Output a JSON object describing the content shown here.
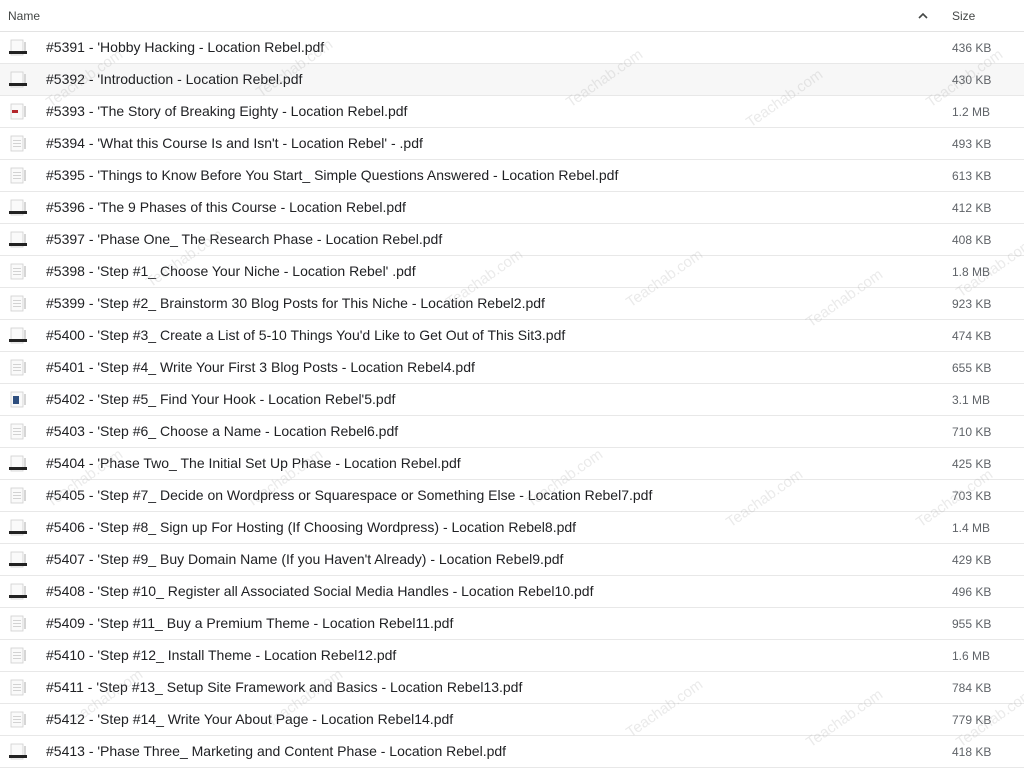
{
  "header": {
    "name_label": "Name",
    "size_label": "Size",
    "sort_icon": "chevron-up-icon"
  },
  "files": [
    {
      "name": "#5391 - 'Hobby Hacking - Location Rebel.pdf",
      "size": "436 KB",
      "thumb": "dark"
    },
    {
      "name": "#5392 - 'Introduction - Location Rebel.pdf",
      "size": "430 KB",
      "thumb": "dark"
    },
    {
      "name": "#5393 - 'The Story of Breaking Eighty - Location Rebel.pdf",
      "size": "1.2 MB",
      "thumb": "red"
    },
    {
      "name": "#5394 - 'What this Course Is and Isn't - Location Rebel' - .pdf",
      "size": "493 KB",
      "thumb": "light"
    },
    {
      "name": "#5395 - 'Things to Know Before You Start_ Simple Questions Answered - Location Rebel.pdf",
      "size": "613 KB",
      "thumb": "light"
    },
    {
      "name": "#5396 - 'The 9 Phases of this Course - Location Rebel.pdf",
      "size": "412 KB",
      "thumb": "dark"
    },
    {
      "name": "#5397 - 'Phase One_ The Research Phase - Location Rebel.pdf",
      "size": "408 KB",
      "thumb": "dark"
    },
    {
      "name": "#5398 - 'Step #1_ Choose Your Niche - Location Rebel' .pdf",
      "size": "1.8 MB",
      "thumb": "light"
    },
    {
      "name": "#5399 - 'Step #2_ Brainstorm 30 Blog Posts for This Niche - Location Rebel2.pdf",
      "size": "923 KB",
      "thumb": "light"
    },
    {
      "name": "#5400 - 'Step #3_ Create a List of 5-10 Things You'd Like to Get Out of This Sit3.pdf",
      "size": "474 KB",
      "thumb": "dark"
    },
    {
      "name": "#5401 - 'Step #4_ Write Your First 3 Blog Posts - Location Rebel4.pdf",
      "size": "655 KB",
      "thumb": "light"
    },
    {
      "name": "#5402 - 'Step #5_ Find Your Hook - Location Rebel'5.pdf",
      "size": "3.1 MB",
      "thumb": "blue"
    },
    {
      "name": "#5403 - 'Step #6_ Choose a Name - Location Rebel6.pdf",
      "size": "710 KB",
      "thumb": "light"
    },
    {
      "name": "#5404 - 'Phase Two_ The Initial Set Up Phase - Location Rebel.pdf",
      "size": "425 KB",
      "thumb": "dark"
    },
    {
      "name": "#5405 - 'Step #7_ Decide on Wordpress or Squarespace or Something Else - Location Rebel7.pdf",
      "size": "703 KB",
      "thumb": "light"
    },
    {
      "name": "#5406 - 'Step #8_ Sign up For Hosting (If Choosing Wordpress) - Location Rebel8.pdf",
      "size": "1.4 MB",
      "thumb": "dark"
    },
    {
      "name": "#5407 - 'Step #9_ Buy Domain Name (If you Haven't Already) - Location Rebel9.pdf",
      "size": "429 KB",
      "thumb": "dark"
    },
    {
      "name": "#5408 - 'Step #10_ Register all Associated Social Media Handles - Location Rebel10.pdf",
      "size": "496 KB",
      "thumb": "dark"
    },
    {
      "name": "#5409 - 'Step #11_ Buy a Premium Theme - Location Rebel11.pdf",
      "size": "955 KB",
      "thumb": "light"
    },
    {
      "name": "#5410 - 'Step #12_ Install Theme - Location Rebel12.pdf",
      "size": "1.6 MB",
      "thumb": "light"
    },
    {
      "name": "#5411 - 'Step #13_ Setup Site Framework and Basics - Location Rebel13.pdf",
      "size": "784 KB",
      "thumb": "light"
    },
    {
      "name": "#5412 - 'Step #14_ Write Your About Page - Location Rebel14.pdf",
      "size": "779 KB",
      "thumb": "light"
    },
    {
      "name": "#5413 - 'Phase Three_ Marketing and Content Phase - Location Rebel.pdf",
      "size": "418 KB",
      "thumb": "dark"
    }
  ],
  "watermark_text": "Teachab.com",
  "colors": {
    "text": "#202124",
    "muted": "#5f6368",
    "divider": "#e8e8e8"
  }
}
